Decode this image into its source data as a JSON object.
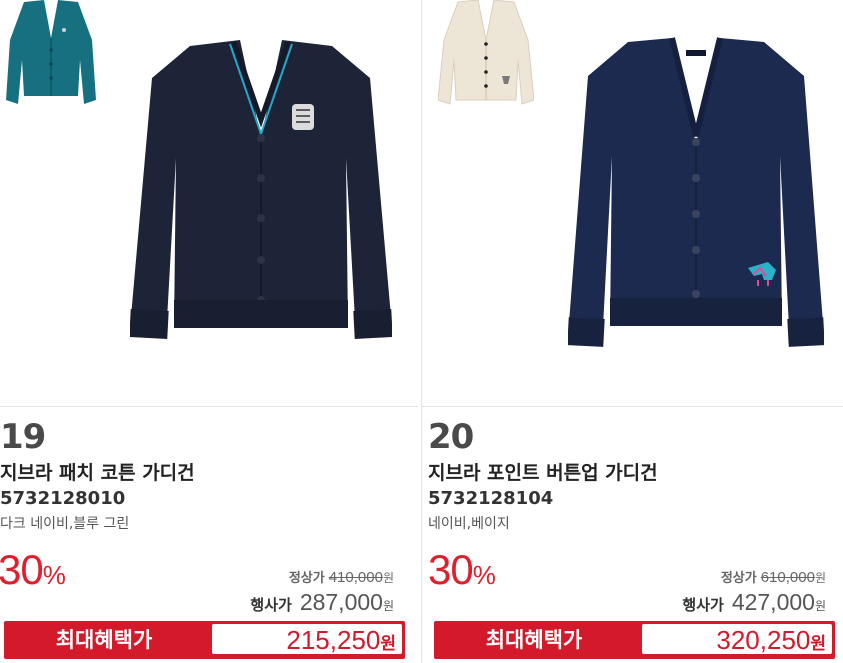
{
  "products": [
    {
      "rank": "19",
      "name": "지브라 패치 코튼 가디건",
      "code": "5732128010",
      "colors": "다크 네이비,블루 그린",
      "discount": "30",
      "discount_unit": "%",
      "regular_label": "정상가",
      "regular_price": "410,000",
      "regular_unit": "원",
      "sale_label": "행사가",
      "sale_price": "287,000",
      "sale_unit": "원",
      "max_label": "최대혜택가",
      "max_price": "215,250",
      "max_unit": "원",
      "main_color": "#1d2438",
      "thumb_color": "#17707f"
    },
    {
      "rank": "20",
      "name": "지브라 포인트 버튼업 가디건",
      "code": "5732128104",
      "colors": "네이비,베이지",
      "discount": "30",
      "discount_unit": "%",
      "regular_label": "정상가",
      "regular_price": "610,000",
      "regular_unit": "원",
      "sale_label": "행사가",
      "sale_price": "427,000",
      "sale_unit": "원",
      "max_label": "최대혜택가",
      "max_price": "320,250",
      "max_unit": "원",
      "main_color": "#1c2a4f",
      "thumb_color": "#ede5d6"
    }
  ],
  "colors": {
    "accent_red": "#d4192b",
    "discount_red": "#e01f2d"
  }
}
